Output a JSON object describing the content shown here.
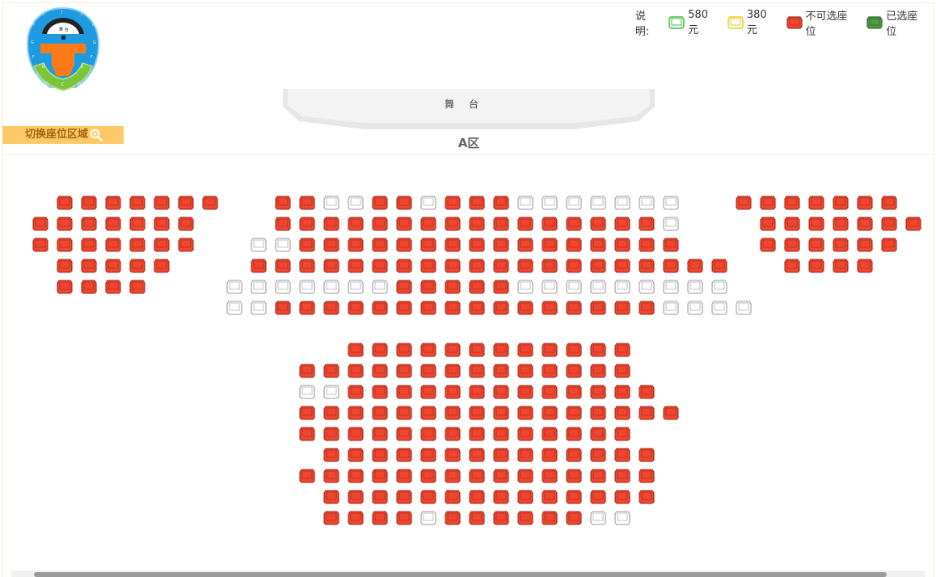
{
  "legend": {
    "title": "说明:",
    "items": [
      {
        "label": "580元",
        "type": "price-580",
        "stroke": "#3fbf3f",
        "fill": "#ffffff"
      },
      {
        "label": "380元",
        "type": "price-380",
        "stroke": "#e8d01a",
        "fill": "#ffffff"
      },
      {
        "label": "不可选座位",
        "type": "unavailable",
        "stroke": "#a02a1a",
        "fill": "#f0462f"
      },
      {
        "label": "已选座位",
        "type": "selected",
        "stroke": "#2f6b2a",
        "fill": "#4f9a43"
      }
    ]
  },
  "minimap": {
    "stage_label": "舞 台",
    "zone_letters": [
      "I",
      "J",
      "I",
      "H",
      "H",
      "G",
      "G",
      "F",
      "F",
      "B",
      "B",
      "E",
      "D",
      "C",
      "D",
      "E",
      "A"
    ]
  },
  "zone_switch_label": "切换座位区域",
  "stage_label": "舞台",
  "area_title": "A区",
  "colors": {
    "unavailable_fill": "#f0462f",
    "unavailable_stroke": "#a02a1a",
    "available_fill": "#ffffff",
    "available_stroke": "#9a9a9a",
    "accent": "#fdc967"
  },
  "seat_rows": [
    "UUUUUUU ... UUAAUUAUUUAAAAAAA ... UUUUUUU",
    "UUUUUUU ... UUUUUUUUUUUUUUUUA ... UUUUUUU",
    "UUUUUUU ... AAUUUUUUUUUUUUUUUU ... UUUUUUU",
    "UUUUU ... UUUUUUUUUUUUUUUUUUUU ... UUUU",
    "UUUU ... AAAAAAAUUUUUAAAAAAAAA",
    "AAUUUUUUUUUUUUUUUUAAAA",
    "UUUUUUUUUUUU",
    "UUUUUUUUUUUUUUU",
    "AAUUUUUUUUUUUUU",
    "UUUUUUUUUUUUUUUU",
    "UUUUUUUUUUUUUUU",
    "UUUUUUUUUUUUUU",
    "UUUUUUUUUUUUUUU",
    "UUUUUUUUUUUUUU",
    "UUUUAUUUUUUAA"
  ]
}
